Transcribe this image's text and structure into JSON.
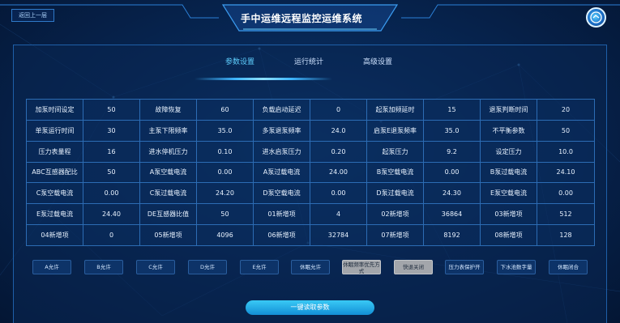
{
  "header": {
    "back_label": "返回上一层",
    "title": "手中运维远程监控运维系统"
  },
  "tabs": [
    {
      "label": "参数设置",
      "active": true
    },
    {
      "label": "运行统计",
      "active": false
    },
    {
      "label": "高级设置",
      "active": false
    }
  ],
  "params": [
    [
      [
        "加泵时间设定",
        "50"
      ],
      [
        "故障恢复",
        "60"
      ],
      [
        "负载启动延迟",
        "0"
      ],
      [
        "起泵加频延时",
        "15"
      ],
      [
        "退泵判断时间",
        "20"
      ]
    ],
    [
      [
        "单泵运行时间",
        "30"
      ],
      [
        "主泵下限频率",
        "35.0"
      ],
      [
        "多泵退泵频率",
        "24.0"
      ],
      [
        "启泵E退泵频率",
        "35.0"
      ],
      [
        "不平衡参数",
        "50"
      ]
    ],
    [
      [
        "压力表量程",
        "16"
      ],
      [
        "进水停机压力",
        "0.10"
      ],
      [
        "进水启泵压力",
        "0.20"
      ],
      [
        "起泵压力",
        "9.2"
      ],
      [
        "设定压力",
        "10.0"
      ]
    ],
    [
      [
        "ABC互感器配比",
        "50"
      ],
      [
        "A泵空载电流",
        "0.00"
      ],
      [
        "A泵过载电流",
        "24.00"
      ],
      [
        "B泵空载电流",
        "0.00"
      ],
      [
        "B泵过载电流",
        "24.10"
      ]
    ],
    [
      [
        "C泵空载电流",
        "0.00"
      ],
      [
        "C泵过载电流",
        "24.20"
      ],
      [
        "D泵空载电流",
        "0.00"
      ],
      [
        "D泵过载电流",
        "24.30"
      ],
      [
        "E泵空载电流",
        "0.00"
      ]
    ],
    [
      [
        "E泵过载电流",
        "24.40"
      ],
      [
        "DE互感器比值",
        "50"
      ],
      [
        "01新增项",
        "4"
      ],
      [
        "02新增项",
        "36864"
      ],
      [
        "03新增项",
        "512"
      ]
    ],
    [
      [
        "04新增项",
        "0"
      ],
      [
        "05新增项",
        "4096"
      ],
      [
        "06新增项",
        "32784"
      ],
      [
        "07新增项",
        "8192"
      ],
      [
        "08新增项",
        "128"
      ]
    ]
  ],
  "controls": [
    {
      "label": "A允许",
      "style": "dark"
    },
    {
      "label": "B允许",
      "style": "dark"
    },
    {
      "label": "C允许",
      "style": "dark"
    },
    {
      "label": "D允许",
      "style": "dark"
    },
    {
      "label": "E允许",
      "style": "dark"
    },
    {
      "label": "休眠允许",
      "style": "dark"
    },
    {
      "label": "休眠频率优先方式",
      "style": "gray"
    },
    {
      "label": "快退关闭",
      "style": "gray"
    },
    {
      "label": "压力表保护开",
      "style": "dark"
    },
    {
      "label": "下水池数字量",
      "style": "dark"
    },
    {
      "label": "休眠闭合",
      "style": "dark"
    }
  ],
  "read_button": "一键读取参数",
  "colors": {
    "accent": "#5fd0ff",
    "grid": "#2c6cb4",
    "button": "#0d3368",
    "read_button": "#1fa8e6"
  }
}
